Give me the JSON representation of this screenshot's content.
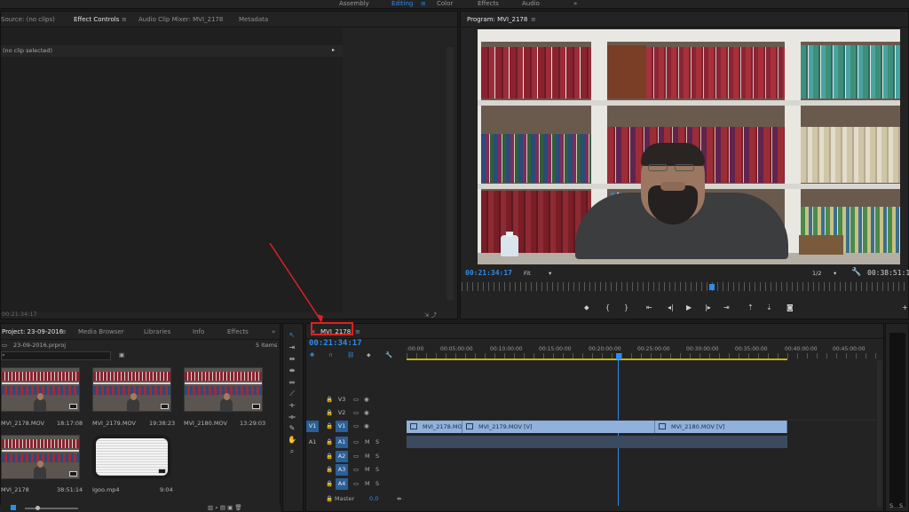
{
  "workspaces": [
    "Assembly",
    "Editing",
    "Color",
    "Effects",
    "Audio"
  ],
  "active_workspace": "Editing",
  "source_panel": {
    "tabs": [
      "Source: (no clips)",
      "Effect Controls",
      "Audio Clip Mixer: MVI_2178",
      "Metadata"
    ],
    "active_tab": "Effect Controls",
    "no_clip_text": "(no clip selected)",
    "timecode": "00:21:34:17"
  },
  "program_monitor": {
    "title": "Program: MVI_2178",
    "current_timecode": "00:21:34:17",
    "fit": "Fit",
    "resolution": "1/2",
    "duration": "00:38:51:14"
  },
  "project_panel": {
    "tabs": [
      "Project: 23-09-2016",
      "Media Browser",
      "Libraries",
      "Info",
      "Effects"
    ],
    "file": "23-09-2016.prproj",
    "items_count": "5 Items",
    "items": [
      {
        "name": "MVI_2178.MOV",
        "duration": "18:17:08"
      },
      {
        "name": "MVI_2179.MOV",
        "duration": "19:38:23"
      },
      {
        "name": "MVI_2180.MOV",
        "duration": "13:29:03"
      },
      {
        "name": "MVI_2178",
        "duration": "38:51:14"
      },
      {
        "name": "Igoo.mp4",
        "duration": "9:04"
      }
    ]
  },
  "timeline": {
    "sequence_tab": "MVI_2178",
    "timecode": "00:21:34:17",
    "ruler": [
      ":00:00",
      "00:05:00:00",
      "00:10:00:00",
      "00:15:00:00",
      "00:20:00:00",
      "00:25:00:00",
      "00:30:00:00",
      "00:35:00:00",
      "00:40:00:00",
      "00:45:00:00"
    ],
    "video_tracks": [
      "V3",
      "V2",
      "V1"
    ],
    "audio_tracks": [
      "A1",
      "A2",
      "A3",
      "A4"
    ],
    "source_patch_v": "V1",
    "source_patch_a": "A1",
    "master_label": "Master",
    "master_value": "0,0",
    "clips": [
      "MVI_2178.MOV",
      "MVI_2179.MOV [V]",
      "MVI_2180.MOV [V]"
    ],
    "mute_label": "M",
    "solo_label": "S"
  },
  "colors": {
    "accent": "#2d8ceb",
    "video_clip": "#8fb1db",
    "audio_clip": "#3c4a5f",
    "annotation": "#e02020"
  },
  "icons": [
    "selection-tool-icon",
    "razor-tool-icon",
    "hand-tool-icon",
    "zoom-tool-icon",
    "pen-tool-icon",
    "play-icon",
    "step-back-icon",
    "step-forward-icon",
    "export-frame-icon",
    "wrench-icon",
    "eye-icon",
    "lock-icon"
  ]
}
